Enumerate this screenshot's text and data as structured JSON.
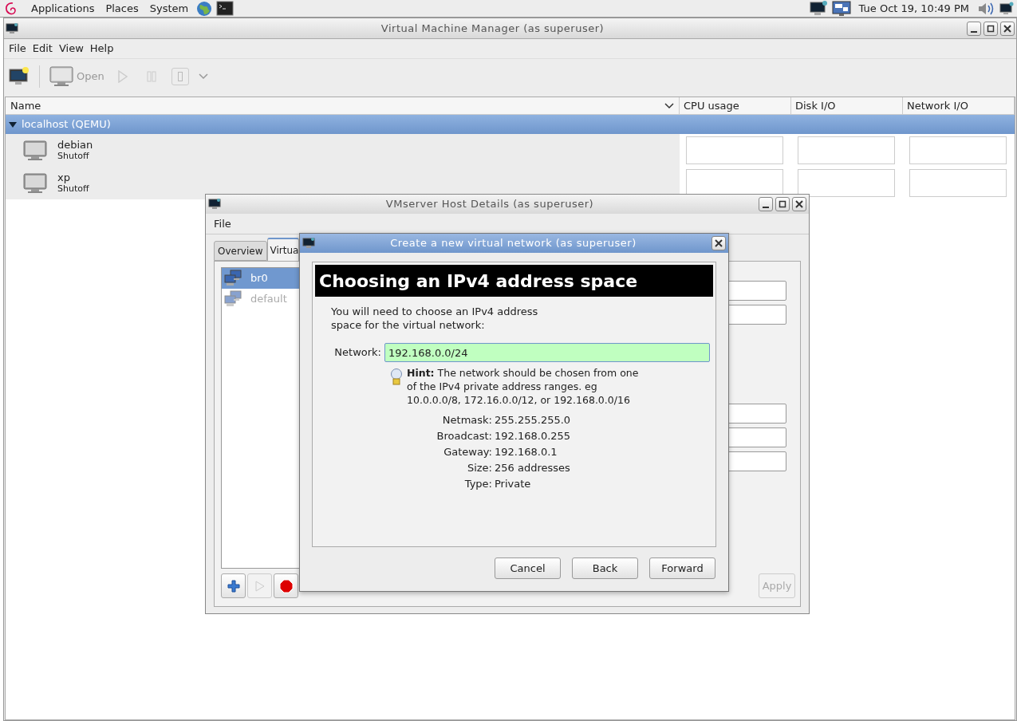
{
  "panel": {
    "menus": [
      "Applications",
      "Places",
      "System"
    ],
    "clock": "Tue Oct 19, 10:49 PM"
  },
  "main_window": {
    "title": "Virtual Machine Manager (as superuser)",
    "menu": [
      "File",
      "Edit",
      "View",
      "Help"
    ],
    "open_label": "Open",
    "columns": [
      "Name",
      "CPU usage",
      "Disk I/O",
      "Network I/O"
    ],
    "group": {
      "label": "localhost (QEMU)",
      "expanded": true
    },
    "vms": [
      {
        "name": "debian",
        "status": "Shutoff"
      },
      {
        "name": "xp",
        "status": "Shutoff"
      }
    ]
  },
  "host_window": {
    "title": "VMserver Host Details (as superuser)",
    "menu": [
      "File"
    ],
    "tabs": [
      {
        "label": "Overview",
        "selected": false
      },
      {
        "label": "Virtua",
        "selected": true
      }
    ],
    "networks": [
      {
        "name": "br0",
        "selected": true,
        "active": true
      },
      {
        "name": "default",
        "selected": false,
        "active": false
      }
    ],
    "apply_label": "Apply"
  },
  "dialog": {
    "title": "Create a new virtual network (as superuser)",
    "heading": "Choosing an IPv4 address space",
    "intro": "You will need to choose an IPv4 address space for the virtual network:",
    "network_label": "Network:",
    "network_value": "192.168.0.0/24",
    "valid": true,
    "hint": "**Hint:** The network should be chosen from one of the IPv4 private address ranges. eg 10.0.0.0/8, 172.16.0.0/12, or 192.168.0.0/16",
    "details": [
      {
        "label": "Netmask:",
        "value": "255.255.255.0"
      },
      {
        "label": "Broadcast:",
        "value": "192.168.0.255"
      },
      {
        "label": "Gateway:",
        "value": "192.168.0.1"
      },
      {
        "label": "Size:",
        "value": "256 addresses"
      },
      {
        "label": "Type:",
        "value": "Private"
      }
    ],
    "buttons": [
      "Cancel",
      "Back",
      "Forward"
    ]
  }
}
